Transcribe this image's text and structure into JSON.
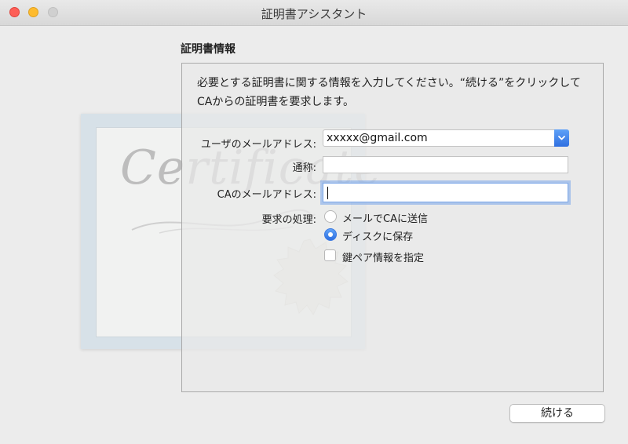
{
  "window": {
    "title": "証明書アシスタント"
  },
  "certificate_art": {
    "script_text": "Certificate"
  },
  "section": {
    "title": "証明書情報",
    "description": "必要とする証明書に関する情報を入力してください。“続ける”をクリックしてCAからの証明書を要求します。"
  },
  "form": {
    "user_email": {
      "label": "ユーザのメールアドレス:",
      "value": "xxxxx@gmail.com"
    },
    "common_name": {
      "label": "通称:",
      "value": ""
    },
    "ca_email": {
      "label": "CAのメールアドレス:",
      "value": ""
    },
    "request": {
      "label": "要求の処理:",
      "options": [
        {
          "label": "メールでCAに送信",
          "selected": false
        },
        {
          "label": "ディスクに保存",
          "selected": true
        }
      ]
    },
    "key_pair": {
      "label": "鍵ペア情報を指定",
      "checked": false
    }
  },
  "buttons": {
    "continue": "続ける"
  },
  "colors": {
    "accent": "#3a78e0",
    "close": "#fd5f57",
    "minimize": "#febb2e"
  },
  "icons": {
    "combo": "chevron-updown-icon"
  }
}
